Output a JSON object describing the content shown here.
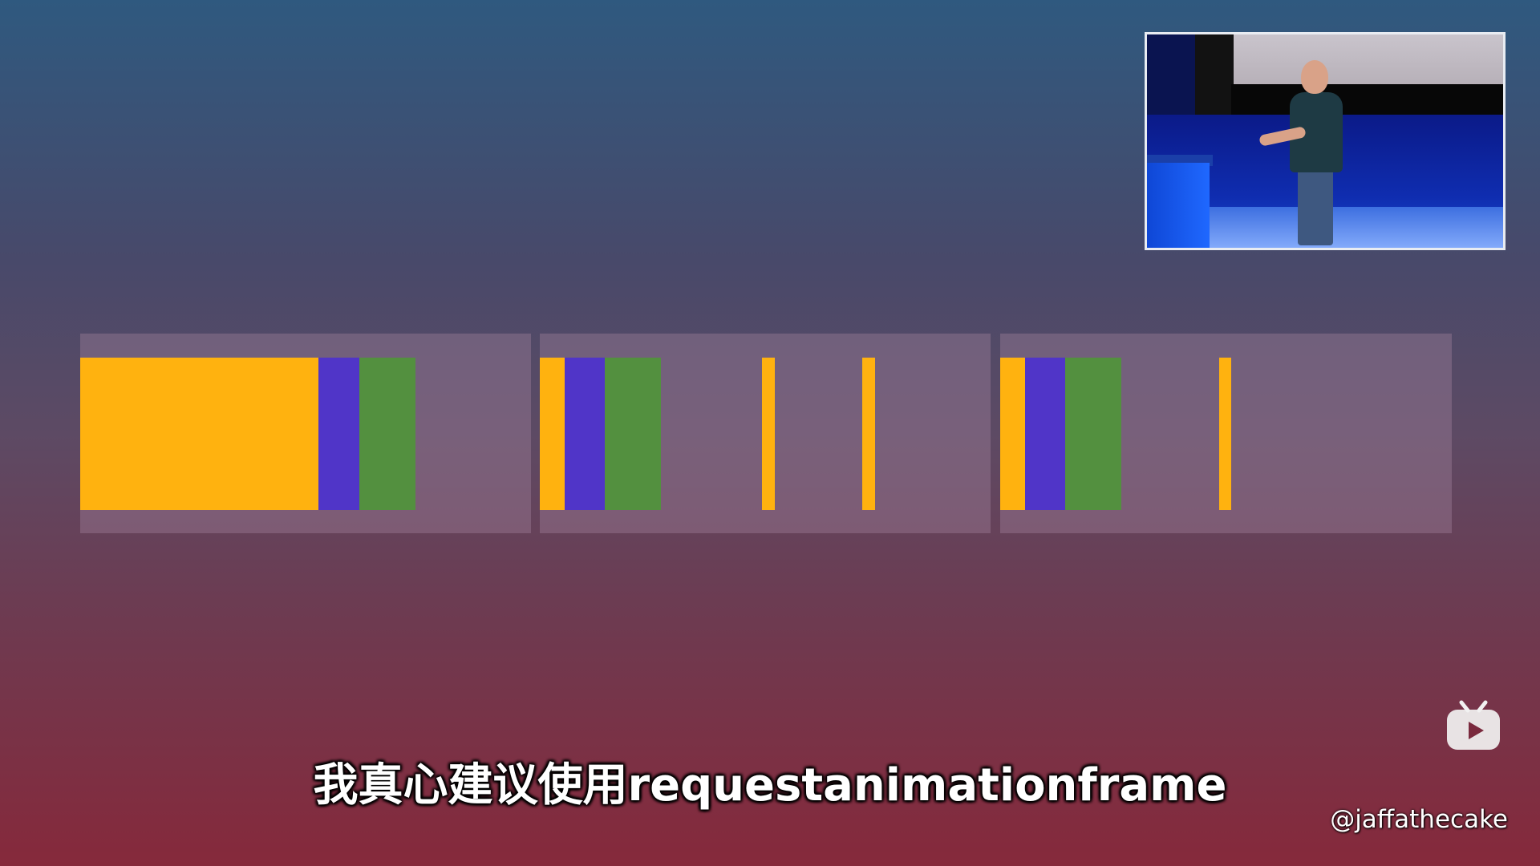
{
  "subtitle": "我真心建议使用requestanimationframe",
  "credit_handle": "@jaffathecake",
  "colors": {
    "frame_bg": "rgba(165,135,160,0.38)",
    "script_task": "#ffb20f",
    "style_task": "#5035c8",
    "paint_task": "#53903f"
  },
  "icons": {
    "logo": "play-tv-icon"
  },
  "timeline": {
    "frames": [
      {
        "name": "frame-1",
        "tasks": [
          {
            "kind": "script",
            "color": "#ffb20f"
          },
          {
            "kind": "style",
            "color": "#5035c8"
          },
          {
            "kind": "paint",
            "color": "#53903f"
          }
        ]
      },
      {
        "name": "frame-2",
        "tasks": [
          {
            "kind": "script",
            "color": "#ffb20f"
          },
          {
            "kind": "style",
            "color": "#5035c8"
          },
          {
            "kind": "paint",
            "color": "#53903f"
          },
          {
            "kind": "script",
            "color": "#ffb20f"
          },
          {
            "kind": "script",
            "color": "#ffb20f"
          }
        ]
      },
      {
        "name": "frame-3",
        "tasks": [
          {
            "kind": "script",
            "color": "#ffb20f"
          },
          {
            "kind": "style",
            "color": "#5035c8"
          },
          {
            "kind": "paint",
            "color": "#53903f"
          },
          {
            "kind": "script",
            "color": "#ffb20f"
          }
        ]
      }
    ]
  }
}
